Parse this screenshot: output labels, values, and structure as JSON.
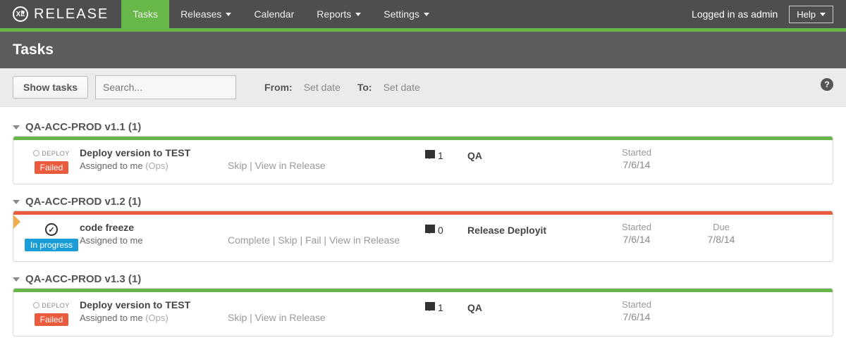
{
  "logo_text": "RELEASE",
  "nav": [
    {
      "label": "Tasks",
      "active": true,
      "dropdown": false
    },
    {
      "label": "Releases",
      "active": false,
      "dropdown": true
    },
    {
      "label": "Calendar",
      "active": false,
      "dropdown": false
    },
    {
      "label": "Reports",
      "active": false,
      "dropdown": true
    },
    {
      "label": "Settings",
      "active": false,
      "dropdown": true
    }
  ],
  "auth_text": "Logged in as admin",
  "help_label": "Help",
  "page_title": "Tasks",
  "filter": {
    "show_btn": "Show tasks",
    "search_placeholder": "Search...",
    "from_label": "From:",
    "from_value": "Set date",
    "to_label": "To:",
    "to_value": "Set date"
  },
  "groups": [
    {
      "title": "QA-ACC-PROD v1.1 (1)",
      "stripe": "green",
      "marker": false,
      "task": {
        "icon_type": "deploy",
        "deploy_tag": "DEPLOY",
        "badge_text": "Failed",
        "badge_class": "failed",
        "title": "Deploy version to TEST",
        "assigned": "Assigned to me",
        "team": "(Ops)",
        "actions": "Skip | View in Release",
        "comments": "1",
        "phase": "QA",
        "started_lbl": "Started",
        "started_val": "7/6/14",
        "due_lbl": "",
        "due_val": ""
      }
    },
    {
      "title": "QA-ACC-PROD v1.2 (1)",
      "stripe": "red",
      "marker": true,
      "task": {
        "icon_type": "check",
        "deploy_tag": "",
        "badge_text": "In progress",
        "badge_class": "inprog",
        "title": "code freeze",
        "assigned": "Assigned to me",
        "team": "",
        "actions": "Complete | Skip | Fail | View in Release",
        "comments": "0",
        "phase": "Release Deployit",
        "started_lbl": "Started",
        "started_val": "7/6/14",
        "due_lbl": "Due",
        "due_val": "7/8/14"
      }
    },
    {
      "title": "QA-ACC-PROD v1.3 (1)",
      "stripe": "green",
      "marker": false,
      "task": {
        "icon_type": "deploy",
        "deploy_tag": "DEPLOY",
        "badge_text": "Failed",
        "badge_class": "failed",
        "title": "Deploy version to TEST",
        "assigned": "Assigned to me",
        "team": "(Ops)",
        "actions": "Skip | View in Release",
        "comments": "1",
        "phase": "QA",
        "started_lbl": "Started",
        "started_val": "7/6/14",
        "due_lbl": "",
        "due_val": ""
      }
    }
  ]
}
